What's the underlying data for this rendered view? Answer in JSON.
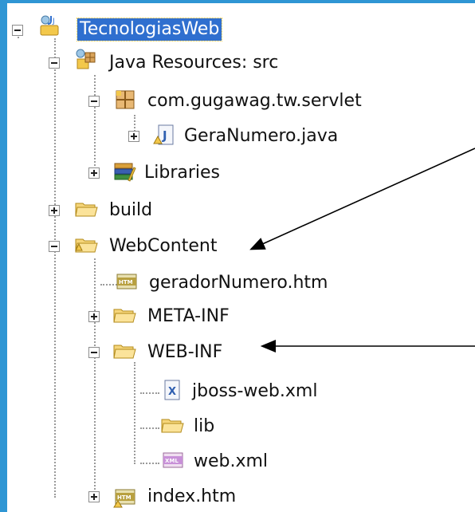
{
  "tree": {
    "items": [
      {
        "label": "TecnologiasWeb"
      },
      {
        "label": "Java Resources: src"
      },
      {
        "label": "com.gugawag.tw.servlet"
      },
      {
        "label": "GeraNumero.java"
      },
      {
        "label": "Libraries"
      },
      {
        "label": "build"
      },
      {
        "label": "WebContent"
      },
      {
        "label": "geradorNumero.htm"
      },
      {
        "label": "META-INF"
      },
      {
        "label": "WEB-INF"
      },
      {
        "label": "jboss-web.xml"
      },
      {
        "label": "lib"
      },
      {
        "label": "web.xml"
      },
      {
        "label": "index.htm"
      }
    ]
  },
  "icons": {
    "project": "web-project-icon",
    "java_resources": "java-resources-icon",
    "package": "package-icon",
    "java_file": "java-file-icon",
    "libraries": "libraries-icon",
    "folder": "folder-icon",
    "htm_file": "htm-file-icon",
    "xml_file": "xml-file-icon",
    "config_file": "config-file-icon",
    "arrow": "arrow-icon"
  },
  "colors": {
    "frame": "#2f96d4",
    "selection": "#2f6fcf",
    "folder": "#f5c542"
  }
}
